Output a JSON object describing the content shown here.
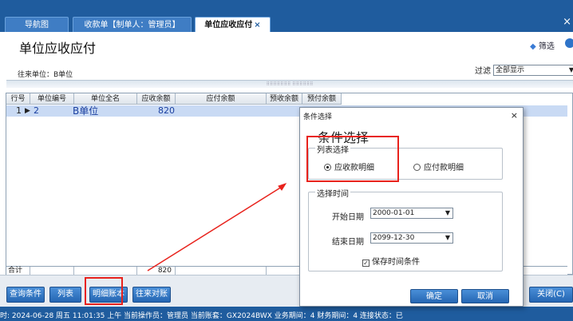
{
  "tabs": [
    {
      "label": "导航图"
    },
    {
      "label": "收款单【制单人：管理员】"
    },
    {
      "label": "单位应收应付",
      "close": "×"
    }
  ],
  "window": {
    "close": "×"
  },
  "page": {
    "title": "单位应收应付",
    "filter_button": "筛选"
  },
  "partner": {
    "label": "往来单位：B单位"
  },
  "filter": {
    "label": "过滤",
    "value": "全部显示"
  },
  "grid": {
    "headers": [
      "行号",
      "单位编号",
      "单位全名",
      "应收余额",
      "应付余额",
      "预收余额",
      "预付余额"
    ],
    "rows": [
      {
        "row_no": "1",
        "marker": "▶",
        "code": "2",
        "name": "B单位",
        "receivable": "820",
        "payable": "",
        "prereceived": "",
        "prepaid": ""
      }
    ],
    "totals": {
      "label": "合计",
      "receivable": "820"
    }
  },
  "toolbar": {
    "query": "查询条件",
    "list": "列表",
    "detail": "明细账本",
    "compare": "往来对账",
    "close": "关闭(C)"
  },
  "status": {
    "text": "时: 2024-06-28 周五 11:01:35 上午          当前操作员：管理员          当前账套：GX2024BWX          业务期间：4          财务期间：4          连接状态：已"
  },
  "dialog": {
    "title": "条件选择",
    "heading": "条件选择",
    "list_group": "列表选择",
    "opt_receivable": "应收款明细",
    "opt_payable": "应付款明细",
    "time_group": "选择时间",
    "start_label": "开始日期",
    "start_value": "2000-01-01",
    "end_label": "结束日期",
    "end_value": "2099-12-30",
    "save_label": "保存时间条件",
    "ok": "确定",
    "cancel": "取消",
    "close": "×"
  },
  "colors": {
    "accent": "#1f5c9e",
    "highlight": "#e8221c",
    "selected_row": "#c9daf4"
  }
}
